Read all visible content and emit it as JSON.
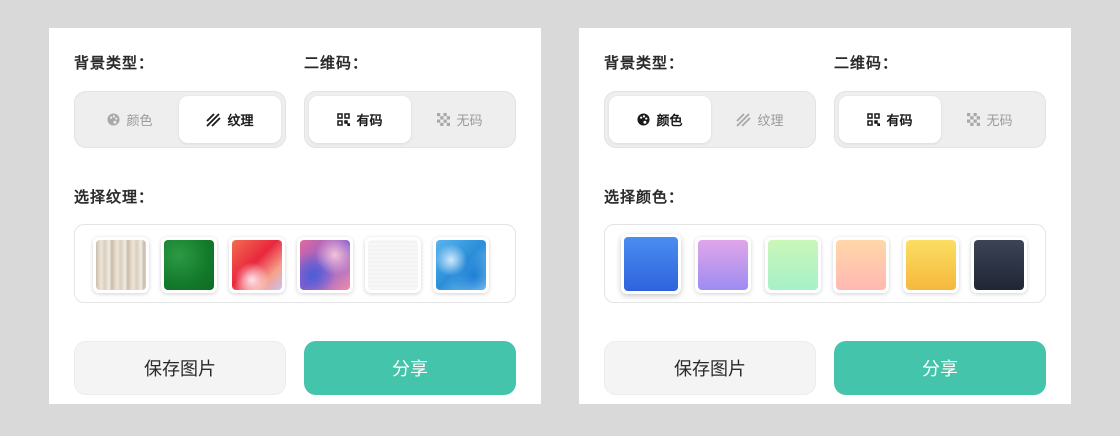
{
  "colors": {
    "accent": "#44c4aa"
  },
  "panels": [
    {
      "bg_type_label": "背景类型：",
      "qr_label": "二维码：",
      "bg_options": [
        {
          "label": "颜色",
          "icon": "palette-icon",
          "active": false
        },
        {
          "label": "纹理",
          "icon": "texture-stripes-icon",
          "active": true
        }
      ],
      "qr_options": [
        {
          "label": "有码",
          "icon": "qrcode-icon",
          "active": true
        },
        {
          "label": "无码",
          "icon": "checker-icon",
          "active": false
        }
      ],
      "select_label": "选择纹理：",
      "swatches": [
        {
          "name": "wood-texture"
        },
        {
          "name": "green-felt-texture"
        },
        {
          "name": "red-abstract-texture"
        },
        {
          "name": "purple-watercolor-texture"
        },
        {
          "name": "white-paper-texture"
        },
        {
          "name": "blue-marble-texture"
        }
      ],
      "save_label": "保存图片",
      "share_label": "分享"
    },
    {
      "bg_type_label": "背景类型：",
      "qr_label": "二维码：",
      "bg_options": [
        {
          "label": "颜色",
          "icon": "palette-icon",
          "active": true
        },
        {
          "label": "纹理",
          "icon": "texture-stripes-icon",
          "active": false
        }
      ],
      "qr_options": [
        {
          "label": "有码",
          "icon": "qrcode-icon",
          "active": true
        },
        {
          "label": "无码",
          "icon": "checker-icon",
          "active": false
        }
      ],
      "select_label": "选择颜色：",
      "swatches": [
        {
          "name": "blue-gradient",
          "colors": [
            "#4a8df0",
            "#2f63dd"
          ],
          "selected": true
        },
        {
          "name": "purple-gradient",
          "colors": [
            "#e0a6ea",
            "#9d8cf0"
          ]
        },
        {
          "name": "green-gradient",
          "colors": [
            "#caf7b8",
            "#a6f0c9"
          ]
        },
        {
          "name": "peach-gradient",
          "colors": [
            "#ffd7a8",
            "#ffb8b3"
          ]
        },
        {
          "name": "yellow-gradient",
          "colors": [
            "#fbde63",
            "#f5b83c"
          ]
        },
        {
          "name": "dark-gradient",
          "colors": [
            "#3c4457",
            "#1f2533"
          ]
        }
      ],
      "save_label": "保存图片",
      "share_label": "分享"
    }
  ]
}
